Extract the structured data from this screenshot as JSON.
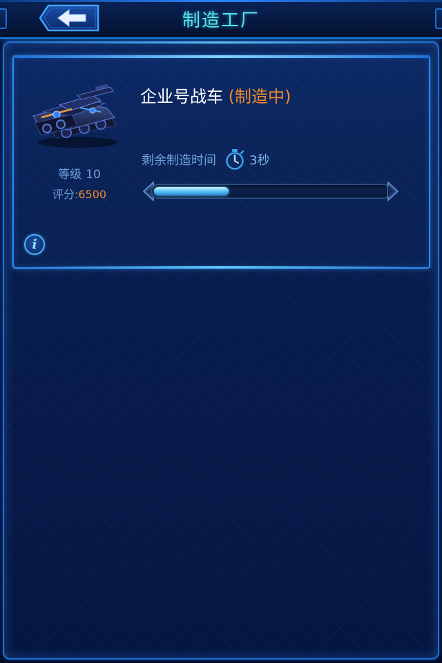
{
  "header": {
    "title": "制造工厂",
    "back_icon": "arrow-left-icon"
  },
  "factory_card": {
    "unit_name": "企业号战车",
    "unit_status": "(制造中)",
    "level_label": "等级",
    "level_value": "10",
    "score_label": "评分:",
    "score_value": "6500",
    "time_label": "剩余制造时间",
    "time_icon": "stopwatch-icon",
    "time_value": "3秒",
    "progress": 0.32,
    "info_icon": "info-icon"
  },
  "colors": {
    "title": "#56e6e8",
    "accent_orange": "#f08a2c",
    "label_blue": "#6fa3dc",
    "border_blue": "#2b8cf0"
  }
}
